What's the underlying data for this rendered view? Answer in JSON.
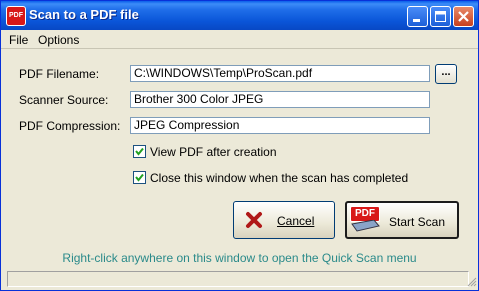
{
  "window": {
    "title": "Scan to a PDF file",
    "app_icon_text": "PDF"
  },
  "menu": {
    "items": [
      "File",
      "Options"
    ]
  },
  "form": {
    "filename_label": "PDF Filename:",
    "filename_value": "C:\\WINDOWS\\Temp\\ProScan.pdf",
    "browse_label": "...",
    "source_label": "Scanner Source:",
    "source_value": "Brother 300 Color JPEG",
    "compression_label": "PDF Compression:",
    "compression_value": "JPEG Compression"
  },
  "options": {
    "view_pdf_label": "View PDF after creation",
    "view_pdf_checked": true,
    "close_window_label": "Close this window when the scan has completed",
    "close_window_checked": true
  },
  "buttons": {
    "cancel_label": "Cancel",
    "start_label": "Start Scan",
    "start_icon_text": "PDF"
  },
  "hint": "Right-click anywhere on this window to open the Quick Scan menu",
  "status": "",
  "colors": {
    "titlebar": "#0a55d8",
    "hint_text": "#2a8a8a",
    "pdf_red": "#d81818"
  }
}
